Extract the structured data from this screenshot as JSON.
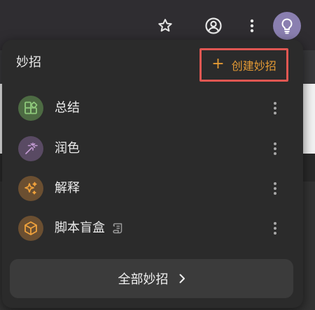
{
  "panel": {
    "title": "妙招",
    "create_label": "创建妙招",
    "items": [
      {
        "label": "总结",
        "icon": "grid-icon",
        "bg": "#4d6b43",
        "fg": "#8fca7c"
      },
      {
        "label": "润色",
        "icon": "magic-wand-icon",
        "bg": "#594a63",
        "fg": "#c69dd6"
      },
      {
        "label": "解释",
        "icon": "sparkle-icon",
        "bg": "#6b4f31",
        "fg": "#f0a23c"
      },
      {
        "label": "脚本盲盒",
        "icon": "cube-icon",
        "bg": "#6b4f31",
        "fg": "#f0a23c",
        "badge_icon": "scroll-icon"
      }
    ],
    "all_label": "全部妙招"
  },
  "colors": {
    "accent": "#e39a34",
    "highlight_box": "#e05752",
    "panel_bg": "#2b2b2b"
  }
}
